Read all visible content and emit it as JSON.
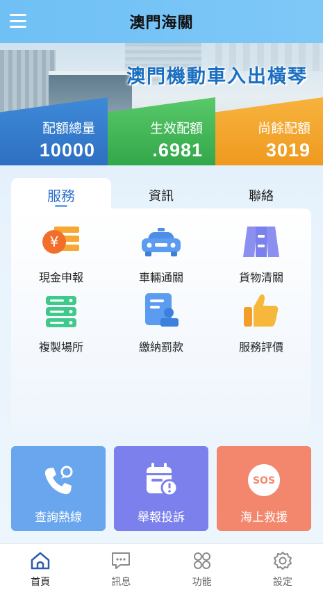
{
  "header": {
    "title": "澳門海關",
    "menu_icon": "hamburger-menu-icon"
  },
  "banner": {
    "title": "澳門機動車入出橫琴",
    "stats": [
      {
        "label": "配額總量",
        "value": "10000",
        "color": "#3a84d4"
      },
      {
        "label": "生效配額",
        "value": ".6981",
        "color": "#46b85a"
      },
      {
        "label": "尚餘配額",
        "value": "3019",
        "color": "#f2a52c"
      }
    ]
  },
  "tabs": [
    {
      "label": "服務",
      "active": true
    },
    {
      "label": "資訊",
      "active": false
    },
    {
      "label": "聯絡",
      "active": false
    }
  ],
  "services": [
    {
      "label": "現金申報",
      "icon": "cash-declaration-icon"
    },
    {
      "label": "車輛通關",
      "icon": "car-icon"
    },
    {
      "label": "貨物清關",
      "icon": "cargo-clearance-icon"
    },
    {
      "label": "複製場所",
      "icon": "server-icon"
    },
    {
      "label": "繳納罰款",
      "icon": "pay-fine-icon"
    },
    {
      "label": "服務評價",
      "icon": "thumbs-up-icon"
    }
  ],
  "actions": [
    {
      "label": "查詢熱線",
      "icon": "phone-icon",
      "color": "#6aa6ee"
    },
    {
      "label": "舉報投訴",
      "icon": "calendar-alert-icon",
      "color": "#7b80ec"
    },
    {
      "label": "海上救援",
      "icon": "sos-icon",
      "icon_text": "SOS",
      "color": "#f3876e"
    }
  ],
  "nav": [
    {
      "label": "首頁",
      "icon": "home-icon",
      "active": true
    },
    {
      "label": "訊息",
      "icon": "message-icon",
      "active": false
    },
    {
      "label": "功能",
      "icon": "grid-icon",
      "active": false
    },
    {
      "label": "設定",
      "icon": "settings-icon",
      "active": false
    }
  ]
}
